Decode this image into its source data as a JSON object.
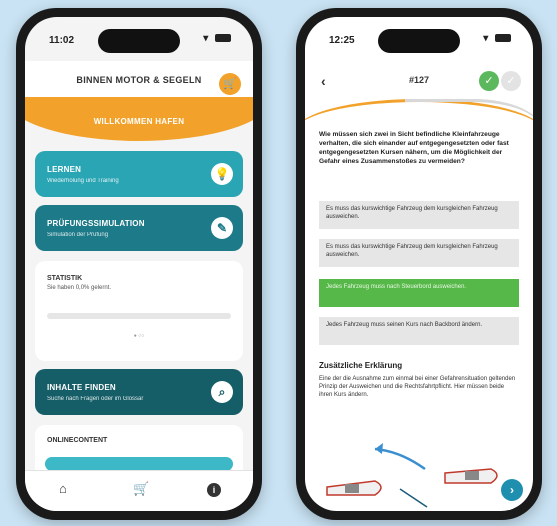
{
  "left_phone": {
    "status_time": "11:02",
    "status_icons": "▾ ●",
    "title": "BINNEN MOTOR & SEGELN",
    "cart_icon": "cart-icon",
    "banner_label": "WILLKOMMEN HAFEN",
    "cards": [
      {
        "title": "LERNEN",
        "subtitle": "Wiederholung und Training",
        "icon": "bulb-icon",
        "glyph": "💡"
      },
      {
        "title": "PRÜFUNGSSIMULATION",
        "subtitle": "Simulation der Prüfung",
        "icon": "pencil-icon",
        "glyph": "✎"
      }
    ],
    "stats": {
      "title": "STATISTIK",
      "subtitle": "Sie haben 0,0% gelernt.",
      "progress": 0,
      "dots": "● ○○"
    },
    "inhalte": {
      "title": "INHALTE FINDEN",
      "subtitle": "Suche nach Fragen oder im Glossar",
      "icon": "search-icon",
      "glyph": "⌕"
    },
    "online": {
      "title": "ONLINECONTENT"
    },
    "tabs": {
      "home": "⌂",
      "shop": "🛒",
      "info": "i"
    }
  },
  "right_phone": {
    "status_time": "12:25",
    "status_icons": "▾ ●",
    "back_glyph": "‹",
    "question_number": "#127",
    "question": "Wie müssen sich zwei in Sicht befindliche Kleinfahrzeuge verhalten, die sich einander auf entgegengesetzten oder fast entgegengesetzten Kursen nähern, um die Möglichkeit der Gefahr eines Zusammenstoßes zu vermeiden?",
    "answers": [
      "Es muss das kurswichtige Fahrzeug dem kursgleichen Fahrzeug ausweichen.",
      "Es muss das kurswichtige Fahrzeug dem kursgleichen Fahrzeug ausweichen.",
      "Jedes Fahrzeug muss nach Steuerbord ausweichen.",
      "Jedes Fahrzeug muss seinen Kurs nach Backbord ändern."
    ],
    "explanation_title": "Zusätzliche Erklärung",
    "explanation": "Eine der die Ausnahme zum einmal bei einer Gefahrensituation geltenden Prinzip der Ausweichen und die Rechtsfahrtpflicht. Hier müssen beide ihren Kurs ändern.",
    "next_glyph": "›"
  }
}
